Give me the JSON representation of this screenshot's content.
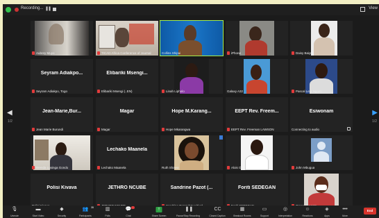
{
  "topbar": {
    "recording_label": "Recording...",
    "view_label": "View"
  },
  "nav": {
    "page_left": "1/2",
    "page_right": "1/2"
  },
  "tiles": [
    {
      "label": "Aubrey Muyo",
      "name": ""
    },
    {
      "label": "TICAD Africa Conference of Journal",
      "name": ""
    },
    {
      "label": "Collins Shipui",
      "name": ""
    },
    {
      "label": "iPhone",
      "name": ""
    },
    {
      "label": "Daisy Baiyu",
      "name": ""
    },
    {
      "label": "Seyram Adiakpo, Togo",
      "name": "Seyram Adiakpo..."
    },
    {
      "label": "Elibariki Msengi (..EN)",
      "name": "Elibariki Msengi..."
    },
    {
      "label": "Linah Lipholo",
      "name": ""
    },
    {
      "label": "Galaxy A32",
      "name": ""
    },
    {
      "label": "Pascal Leyr Ngom",
      "name": ""
    },
    {
      "label": "Jean Marie Burundi",
      "name": "Jean-Marie,Bur..."
    },
    {
      "label": "Magar",
      "name": "Magar"
    },
    {
      "label": "Hope Mkarangwa",
      "name": "Hope M.Karang..."
    },
    {
      "label": "EEPT Rev. Freeman LAWSON",
      "name": "EEPT Rev. Freem..."
    },
    {
      "label": "Connecting to audio",
      "name": "Esiwonam"
    },
    {
      "label": "Brenda Lusinga Gondo",
      "name": ""
    },
    {
      "label": "Lechako Maanela",
      "name": "Lechako Maanela"
    },
    {
      "label": "Ruth Shawa",
      "name": ""
    },
    {
      "label": "Alois Ol",
      "name": ""
    },
    {
      "label": "John Mbugua",
      "name": ""
    },
    {
      "label": "Polisi Kivava",
      "name": "Polisi Kivava"
    },
    {
      "label": "JETHRO NCUBE",
      "name": "JETHRO NCUBE"
    },
    {
      "label": "Sandrine Pazot (Mauritius)",
      "name": "Sandrine Pazot (..."
    },
    {
      "label": "Foriti SEDEGAN",
      "name": "Foriti SEDEGAN"
    },
    {
      "label": "Grace Kangata",
      "name": ""
    }
  ],
  "toolbar": {
    "unmute": "Unmute",
    "start_video": "Start Video",
    "security": "Security",
    "participants": "Participants",
    "participants_count": "35",
    "polls": "Polls",
    "chat": "Chat",
    "share_screen": "Share Screen",
    "pause_recording": "Pause/Stop Recording",
    "closed_caption": "Closed Caption",
    "breakout_rooms": "Breakout Rooms",
    "support": "Support",
    "interpretation": "Interpretation",
    "reactions": "Reactions",
    "apps": "Apps",
    "more": "More",
    "end": "End"
  },
  "colors": {
    "active_speaker": "#a6ef4a",
    "end_button": "#d8342c",
    "share_screen": "#2ea043",
    "nav_right": "#39a0ff"
  }
}
